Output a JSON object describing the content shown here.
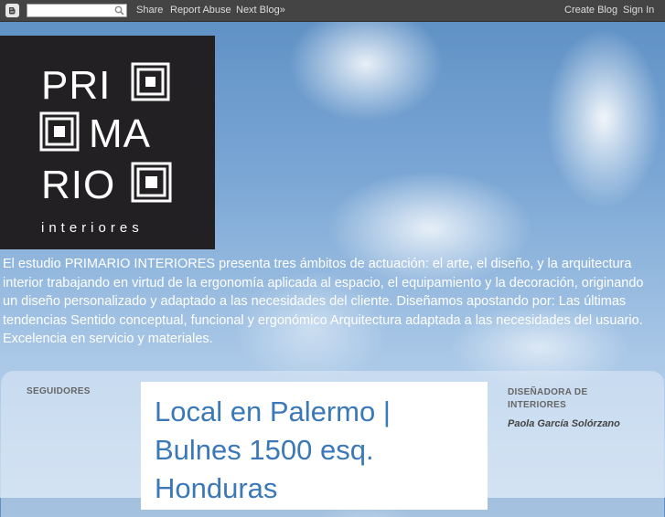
{
  "navbar": {
    "links": [
      "Share",
      "Report Abuse",
      "Next Blog»"
    ],
    "right_links": [
      "Create Blog",
      "Sign In"
    ],
    "search_placeholder": ""
  },
  "header": {
    "logo_text": [
      "PRI",
      "MA",
      "RIO",
      "interiores"
    ],
    "description": "El estudio PRIMARIO INTERIORES presenta tres ámbitos de actuación: el arte, el diseño, y la arquitectura interior trabajando en virtud de la ergonomía aplicada al espacio, el equipamiento y la decoración, originando un diseño personalizado y adaptado a las necesidades del cliente. Diseñamos apostando por: Las últimas tendencias   Sentido conceptual, funcional y ergonómico   Arquitectura adaptada a las necesidades del usuario.   Excelencia en servicio y materiales."
  },
  "sidebar_left": {
    "title": "SEGUIDORES"
  },
  "post": {
    "title": "Local en Palermo | Bulnes 1500 esq. Honduras"
  },
  "sidebar_right": {
    "title": "DISEÑADORA DE INTERIORES",
    "name": "Paola García Solórzano"
  },
  "colors": {
    "navbar_bg": "#444444",
    "post_title": "#3a78b8",
    "logo_bg": "#222022"
  }
}
